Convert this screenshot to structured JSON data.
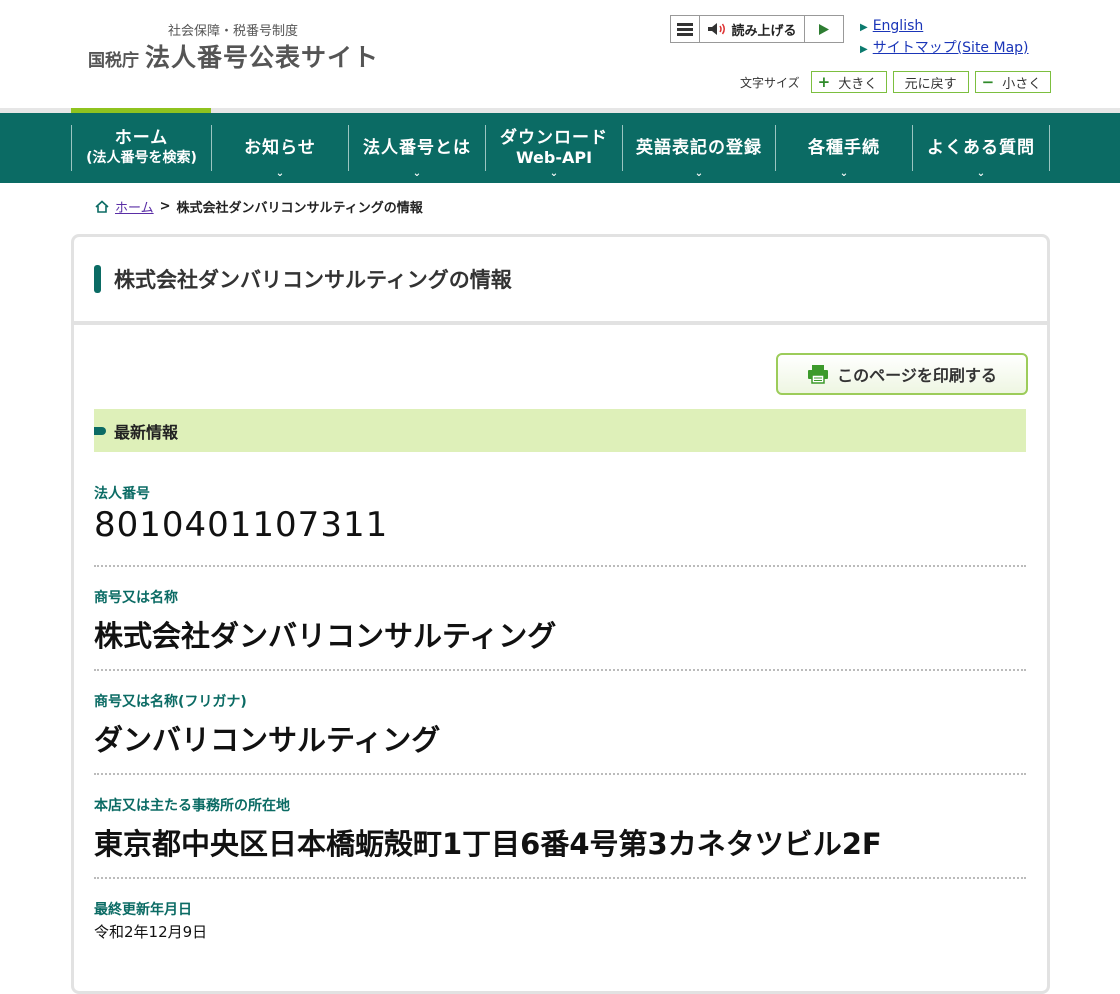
{
  "header": {
    "subtitle": "社会保障・税番号制度",
    "agency": "国税庁",
    "site_title": "法人番号公表サイト",
    "read_aloud_label": "読み上げる",
    "links": [
      "English",
      "サイトマップ(Site Map)"
    ],
    "font_size_label": "文字サイズ",
    "font_buttons": [
      {
        "symbol": "+",
        "label": "大きく"
      },
      {
        "symbol": "",
        "label": "元に戻す"
      },
      {
        "symbol": "−",
        "label": "小さく"
      }
    ]
  },
  "nav": {
    "items": [
      {
        "line1": "ホーム",
        "line2": "(法人番号を検索)",
        "chevron": false
      },
      {
        "line1": "お知らせ",
        "line2": "",
        "chevron": true
      },
      {
        "line1": "法人番号とは",
        "line2": "",
        "chevron": true
      },
      {
        "line1": "ダウンロード",
        "line2": "Web-API",
        "chevron": true
      },
      {
        "line1": "英語表記の登録",
        "line2": "",
        "chevron": true
      },
      {
        "line1": "各種手続",
        "line2": "",
        "chevron": true
      },
      {
        "line1": "よくある質問",
        "line2": "",
        "chevron": true
      }
    ]
  },
  "breadcrumb": {
    "home": "ホーム",
    "separator": ">",
    "current": "株式会社ダンバリコンサルティングの情報"
  },
  "page": {
    "title": "株式会社ダンバリコンサルティングの情報",
    "print_label": "このページを印刷する",
    "section_title": "最新情報"
  },
  "fields": [
    {
      "label": "法人番号",
      "value": "8010401107311"
    },
    {
      "label": "商号又は名称",
      "value": "株式会社ダンバリコンサルティング"
    },
    {
      "label": "商号又は名称(フリガナ)",
      "value": "ダンバリコンサルティング"
    },
    {
      "label": "本店又は主たる事務所の所在地",
      "value": "東京都中央区日本橋蛎殻町1丁目6番4号第3カネタツビル2F"
    },
    {
      "label": "最終更新年月日",
      "value": "令和2年12月9日"
    }
  ],
  "colors": {
    "brand_green": "#0b6b64",
    "accent_lime": "#8fc31f",
    "section_bg": "#def0b9",
    "link_blue": "#1a35b8"
  }
}
